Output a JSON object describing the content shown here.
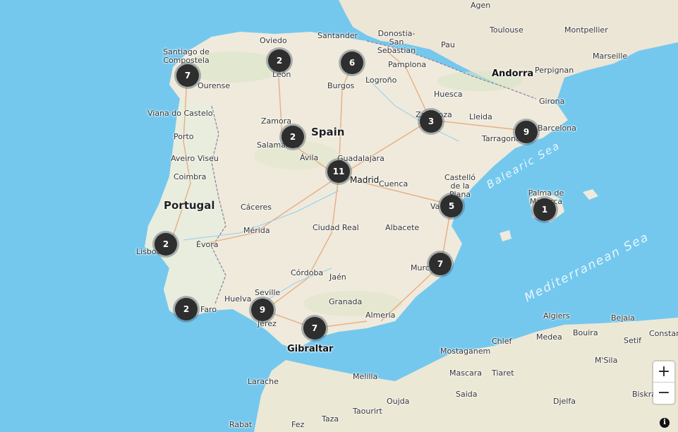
{
  "map": {
    "countries": [
      {
        "id": "spain",
        "name": "Spain"
      },
      {
        "id": "portugal",
        "name": "Portugal"
      },
      {
        "id": "andorra",
        "name": "Andorra"
      },
      {
        "id": "gibraltar",
        "name": "Gibraltar"
      }
    ],
    "seas": [
      {
        "id": "balearic-sea",
        "name": "Balearic Sea"
      },
      {
        "id": "mediterranean-sea",
        "name": "Mediterranean Sea"
      }
    ],
    "cities": [
      "Agen",
      "Toulouse",
      "Montpellier",
      "Marseille",
      "Pau",
      "Perpignan",
      "Girona",
      "Barcelona",
      "Tarragona",
      "Lleida",
      "Huesca",
      "Zaragoza",
      "Pamplona",
      "Donostia-San Sebastian",
      "Santander",
      "Oviedo",
      "León",
      "Santiago de Compostela",
      "Ourense",
      "Viana do Castelo",
      "Porto",
      "Aveiro",
      "Viseu",
      "Coimbra",
      "Zamora",
      "Salamanca",
      "Ávila",
      "Burgos",
      "Logroño",
      "Guadalajara",
      "Madrid",
      "Cuenca",
      "Castelló de la Plana",
      "Valencia",
      "Palma de Mallorca",
      "Cáceres",
      "Mérida",
      "Évora",
      "Lisboa",
      "Ciudad Real",
      "Albacete",
      "Murcia",
      "Córdoba",
      "Jaén",
      "Huelva",
      "Seville",
      "Faro",
      "Jerez",
      "Granada",
      "Almeria",
      "Algiers",
      "Bejaia",
      "Constantine",
      "Bouira",
      "Setif",
      "Medea",
      "M'Sila",
      "Chlef",
      "Mostaganem",
      "Mascara",
      "Tiaret",
      "Saida",
      "Djelfa",
      "Biskra",
      "Melilla",
      "Oujda",
      "Taourirt",
      "Larache",
      "Rabat",
      "Fez",
      "Taza"
    ],
    "clusters": [
      {
        "id": "santiago",
        "count": "7"
      },
      {
        "id": "oviedo",
        "count": "2"
      },
      {
        "id": "cantabria",
        "count": "6"
      },
      {
        "id": "zaragoza",
        "count": "3"
      },
      {
        "id": "barcelona",
        "count": "9"
      },
      {
        "id": "salamanca",
        "count": "2"
      },
      {
        "id": "madrid",
        "count": "11"
      },
      {
        "id": "valencia",
        "count": "5"
      },
      {
        "id": "palma",
        "count": "1"
      },
      {
        "id": "lisbon",
        "count": "2"
      },
      {
        "id": "murcia",
        "count": "7"
      },
      {
        "id": "faro",
        "count": "2"
      },
      {
        "id": "seville",
        "count": "9"
      },
      {
        "id": "malaga",
        "count": "7"
      }
    ]
  },
  "controls": {
    "zoom_in": "+",
    "zoom_out": "−",
    "info": "i"
  },
  "colors": {
    "sea": "#74c8ee",
    "land": "#efeadc",
    "cluster": "#2e2e2e"
  }
}
